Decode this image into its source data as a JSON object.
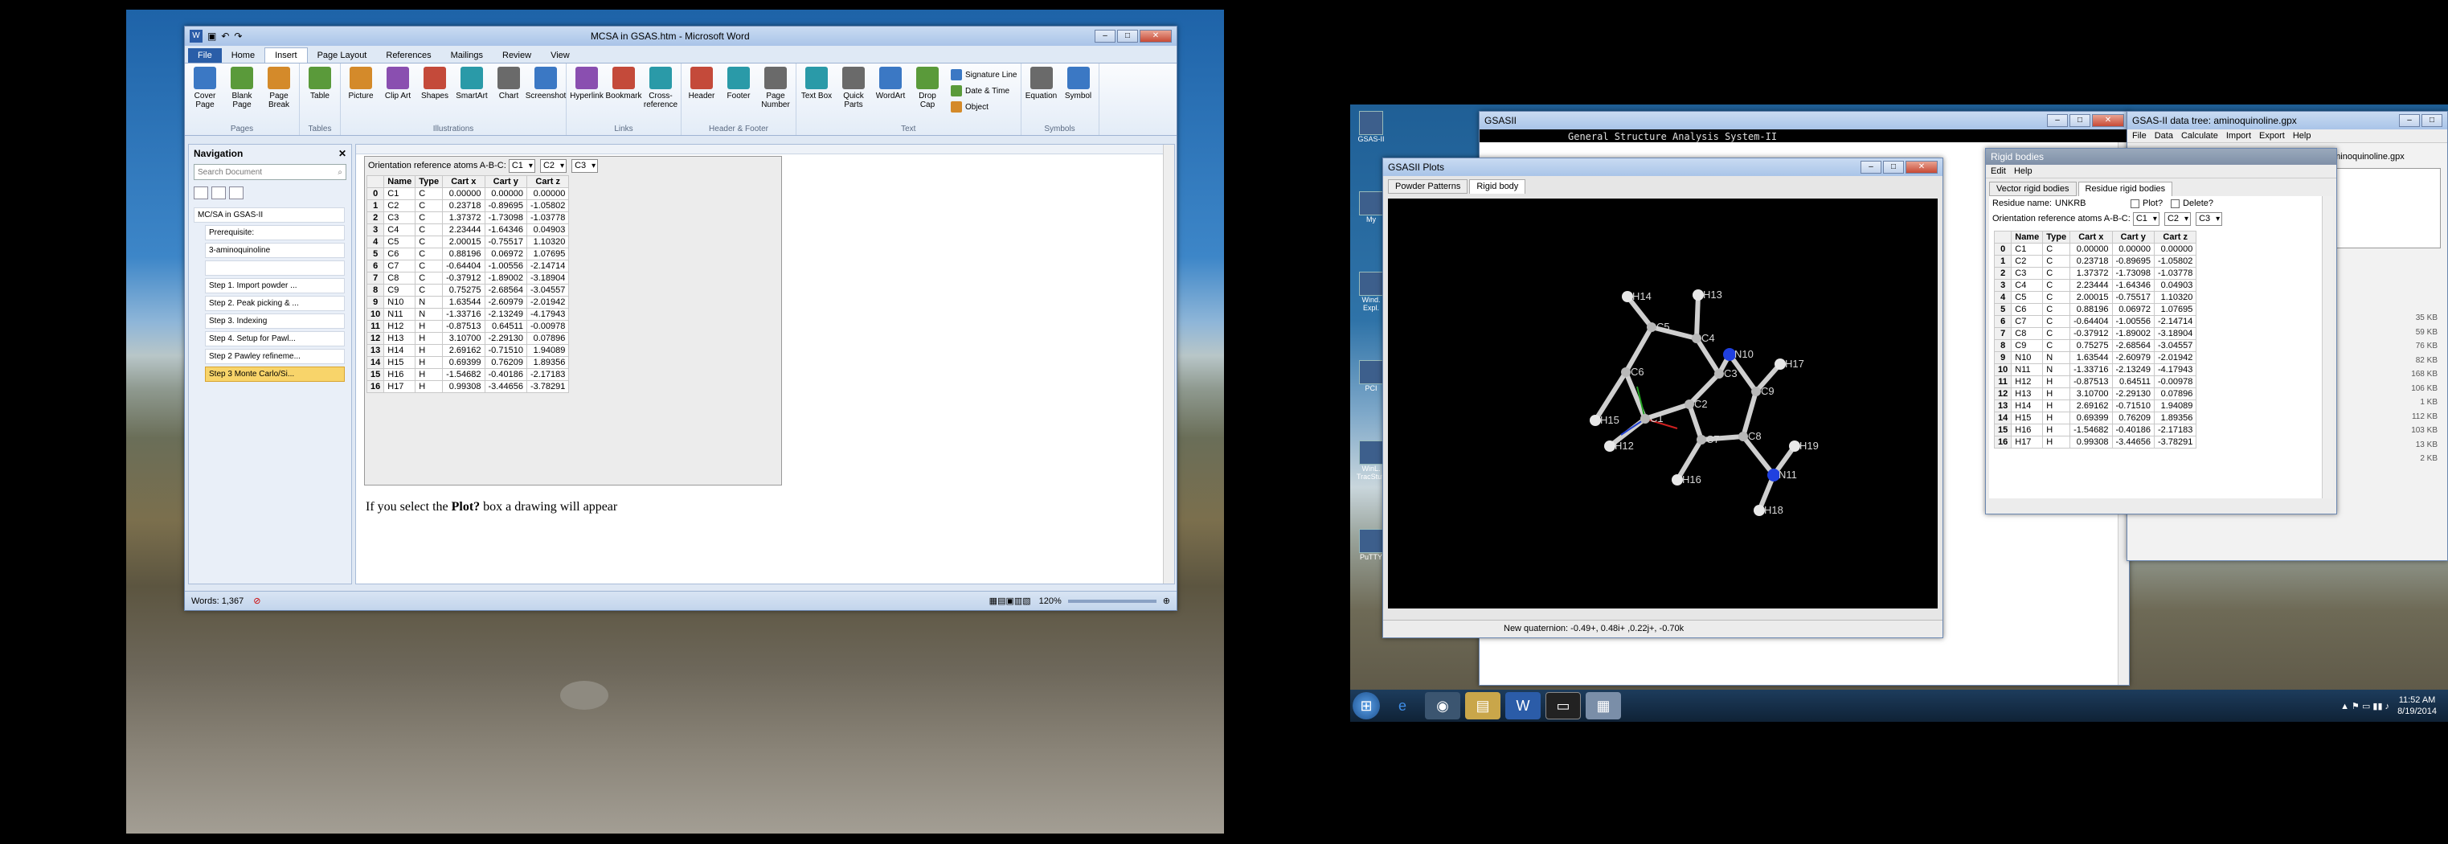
{
  "word": {
    "title": "MCSA in GSAS.htm - Microsoft Word",
    "tabs": [
      "File",
      "Home",
      "Insert",
      "Page Layout",
      "References",
      "Mailings",
      "Review",
      "View"
    ],
    "ribbon_groups": [
      {
        "label": "Pages",
        "items": [
          "Cover Page",
          "Blank Page",
          "Page Break"
        ]
      },
      {
        "label": "Tables",
        "items": [
          "Table"
        ]
      },
      {
        "label": "Illustrations",
        "items": [
          "Picture",
          "Clip Art",
          "Shapes",
          "SmartArt",
          "Chart",
          "Screenshot"
        ]
      },
      {
        "label": "Links",
        "items": [
          "Hyperlink",
          "Bookmark",
          "Cross-reference"
        ]
      },
      {
        "label": "Header & Footer",
        "items": [
          "Header",
          "Footer",
          "Page Number"
        ]
      },
      {
        "label": "Text",
        "items": [
          "Text Box",
          "Quick Parts",
          "WordArt",
          "Drop Cap"
        ]
      },
      {
        "label": "Symbols",
        "items": [
          "Equation",
          "Symbol"
        ]
      }
    ],
    "text_small": [
      "Signature Line",
      "Date & Time",
      "Object"
    ],
    "nav": {
      "title": "Navigation",
      "search_placeholder": "Search Document",
      "items": [
        "MC/SA in GSAS-II",
        "Prerequisite:",
        "3-aminoquinoline",
        "",
        "Step 1. Import powder ...",
        "Step 2. Peak picking & ...",
        "Step 3. Indexing",
        "Step 4. Setup for Pawl...",
        "Step 2 Pawley refineme...",
        "Step 3 Monte Carlo/Si..."
      ],
      "selected_index": 9
    },
    "doc_caption_before": "If you select the ",
    "doc_caption_bold": "Plot?",
    "doc_caption_after": " box a drawing will appear",
    "orient_label": "Orientation reference atoms A-B-C:",
    "orient_values": [
      "C1",
      "C2",
      "C3"
    ],
    "status_words": "Words: 1,367",
    "zoom": "120%"
  },
  "atom_table": {
    "headers": [
      "",
      "Name",
      "Type",
      "Cart x",
      "Cart y",
      "Cart z"
    ],
    "rows": [
      [
        "0",
        "C1",
        "C",
        "0.00000",
        "0.00000",
        "0.00000"
      ],
      [
        "1",
        "C2",
        "C",
        "0.23718",
        "-0.89695",
        "-1.05802"
      ],
      [
        "2",
        "C3",
        "C",
        "1.37372",
        "-1.73098",
        "-1.03778"
      ],
      [
        "3",
        "C4",
        "C",
        "2.23444",
        "-1.64346",
        "0.04903"
      ],
      [
        "4",
        "C5",
        "C",
        "2.00015",
        "-0.75517",
        "1.10320"
      ],
      [
        "5",
        "C6",
        "C",
        "0.88196",
        "0.06972",
        "1.07695"
      ],
      [
        "6",
        "C7",
        "C",
        "-0.64404",
        "-1.00556",
        "-2.14714"
      ],
      [
        "7",
        "C8",
        "C",
        "-0.37912",
        "-1.89002",
        "-3.18904"
      ],
      [
        "8",
        "C9",
        "C",
        "0.75275",
        "-2.68564",
        "-3.04557"
      ],
      [
        "9",
        "N10",
        "N",
        "1.63544",
        "-2.60979",
        "-2.01942"
      ],
      [
        "10",
        "N11",
        "N",
        "-1.33716",
        "-2.13249",
        "-4.17943"
      ],
      [
        "11",
        "H12",
        "H",
        "-0.87513",
        "0.64511",
        "-0.00978"
      ],
      [
        "12",
        "H13",
        "H",
        "3.10700",
        "-2.29130",
        "0.07896"
      ],
      [
        "13",
        "H14",
        "H",
        "2.69162",
        "-0.71510",
        "1.94089"
      ],
      [
        "14",
        "H15",
        "H",
        "0.69399",
        "0.76209",
        "1.89356"
      ],
      [
        "15",
        "H16",
        "H",
        "-1.54682",
        "-0.40186",
        "-2.17183"
      ],
      [
        "16",
        "H17",
        "H",
        "0.99308",
        "-3.44656",
        "-3.78291"
      ]
    ]
  },
  "gsas_plots": {
    "title": "GSASII Plots",
    "tabs": [
      "Powder Patterns",
      "Rigid body"
    ],
    "status": "New quaternion: -0.49+, 0.48i+ ,0.22j+, -0.70k",
    "atoms": [
      "C1",
      "C2",
      "C3",
      "C4",
      "C5",
      "C6",
      "C7",
      "C8",
      "C9",
      "N10",
      "N11",
      "H12",
      "H13",
      "H14",
      "H15",
      "H16",
      "H17",
      "H18",
      "H19"
    ]
  },
  "rigid_bodies": {
    "title": "Rigid bodies",
    "menu": [
      "Edit",
      "Help"
    ],
    "tabs": [
      "Vector rigid bodies",
      "Residue rigid bodies"
    ],
    "residue_name_label": "Residue name:",
    "residue_name": "UNKRB",
    "plot_label": "Plot?",
    "delete_label": "Delete?",
    "orient_label": "Orientation reference atoms A-B-C:"
  },
  "gsas_main": {
    "title": "GSASII",
    "banner": "General Structure Analysis System-II"
  },
  "data_tree": {
    "title": "GSAS-II data tree: aminoquinoline.gpx",
    "menu": [
      "File",
      "Data",
      "Calculate",
      "Import",
      "Export",
      "Help"
    ],
    "filename": "aminoquinoline.gpx",
    "sizes": [
      "35 KB",
      "59 KB",
      "76 KB",
      "82 KB",
      "168 KB",
      "106 KB",
      "1 KB",
      "112 KB",
      "103 KB",
      "13 KB",
      "2 KB"
    ]
  },
  "desktop_icons": [
    "GSAS-II",
    "My",
    "Wind. Expl.",
    "PCI",
    "WinL. TracStuff",
    "PuTTY"
  ],
  "taskbar": {
    "time": "11:52 AM",
    "date": "8/19/2014"
  }
}
